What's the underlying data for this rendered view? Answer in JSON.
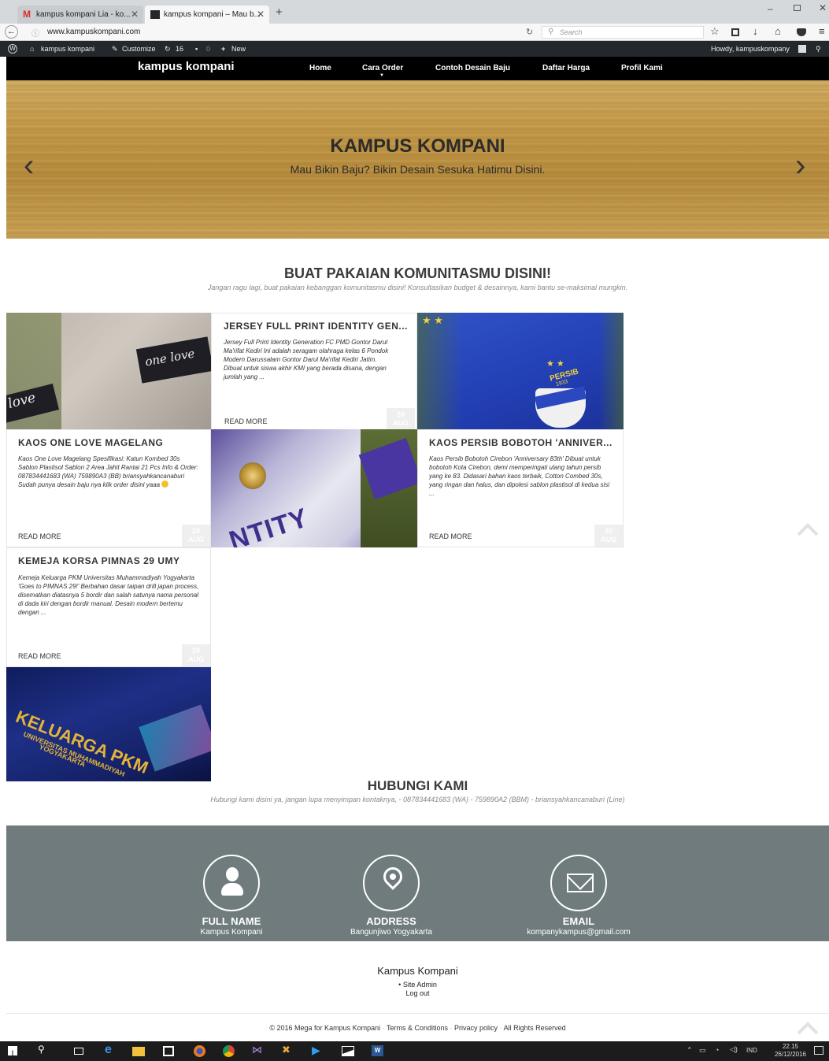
{
  "browser": {
    "tabs": [
      {
        "title": "kampus kompani Lia - ko..."
      },
      {
        "title": "kampus kompani – Mau b..."
      }
    ],
    "url": "www.kampuskompani.com",
    "search_placeholder": "Search"
  },
  "adminbar": {
    "site_name": "kampus kompani",
    "customize": "Customize",
    "updates_count": "16",
    "comments_count": "0",
    "new_label": "New",
    "howdy": "Howdy, kampuskompany"
  },
  "nav": {
    "brand": "kampus kompani",
    "items": [
      {
        "label": "Home"
      },
      {
        "label": "Cara Order"
      },
      {
        "label": "Contoh Desain Baju"
      },
      {
        "label": "Daftar Harga"
      },
      {
        "label": "Profil Kami"
      }
    ]
  },
  "hero": {
    "title": "KAMPUS KOMPANI",
    "subtitle": "Mau Bikin Baju? Bikin Desain Sesuka Hatimu Disini.",
    "prev": "‹",
    "next": "›"
  },
  "community": {
    "title": "BUAT PAKAIAN KOMUNITASMU DISINI!",
    "subtitle": "Jangan ragu lagi, buat pakaian kebanggan komunitasmu disini! Konsultasikan budget & desainnya, kami bantu se-maksimal mungkin."
  },
  "posts": [
    {
      "title": "JERSEY FULL PRINT IDENTITY GEN...",
      "excerpt": "Jersey Full Print Identity Generation FC PMD Gontor Darul Ma'rifat Kediri Ini adalah seragam olahraga kelas 6 Pondok Modern Darussalam Gontor Darul Ma'rifat Kediri Jatim. Dibuat untuk siswa akhir KMI yang berada disana, dengan jumlah yang ...",
      "read_more": "READ MORE",
      "day": "20",
      "month": "AUG"
    },
    {
      "title": "KAOS ONE LOVE MAGELANG",
      "excerpt": "Kaos One Love Magelang Spesifikasi: Katun Kombed 30s Sablon Plastisol Sablon 2 Area Jahit Rantai 21 Pcs Info & Order: 087834441683 (WA) 759890A3 (BB) briansyahkancanaburi Sudah punya desain baju nya klik order disini yaaa",
      "read_more": "READ MORE",
      "day": "20",
      "month": "AUG"
    },
    {
      "title": "KAOS PERSIB BOBOTOH 'ANNIVER...",
      "excerpt": "Kaos Persib Bobotoh Cirebon 'Anniversary 83th' Dibuat untuk bobotoh Kota Cirebon, demi memperingati ulang tahun persib yang ke 83. Didasari bahan kaos terbaik, Cotton Combed 30s, yang ringan dan halus, dan dipolesi sablon plastisol di kedua sisi ...",
      "read_more": "READ MORE",
      "day": "20",
      "month": "AUG"
    },
    {
      "title": "KEMEJA KORSA PIMNAS 29 UMY",
      "excerpt": "Kemeja Keluarga PKM Universitas Muhammadiyah Yogyakarta 'Goes to PIMNAS 29!' Berbahan dasar taipan drill japan process, disematkan diatasnya 5 bordir dan salah satunya nama personal di dada kiri dengan bordir manual. Desain modern bertemu dengan ...",
      "read_more": "READ MORE",
      "day": "20",
      "month": "AUG"
    }
  ],
  "image_text": {
    "one_love": "one love",
    "love": "love",
    "persib": "PERSIB",
    "persib_year": "1933",
    "entity": "NTITY",
    "keluarga": "KELUARGA PKM",
    "universitas": "UNIVERSITAS MUHAMMADIYAH",
    "yogyakarta": "YOGYAKARTA"
  },
  "contact": {
    "title": "HUBUNGI KAMI",
    "subtitle": "Hubungi kami disini ya, jangan lupa menyimpan kontaknya, - 087834441683 (WA) - 759890A2 (BBM) - briansyahkancanaburi (Line)",
    "items": [
      {
        "label": "FULL NAME",
        "value": "Kampus Kompani",
        "icon": "person-icon"
      },
      {
        "label": "ADDRESS",
        "value": "Bangunjiwo Yogyakarta",
        "icon": "location-pin-icon"
      },
      {
        "label": "EMAIL",
        "value": "kompanykampus@gmail.com",
        "icon": "envelope-icon"
      }
    ]
  },
  "widget": {
    "title": "Kampus Kompani",
    "site_admin": "Site Admin",
    "logout": "Log out"
  },
  "footer": {
    "copyright": "© 2016 Mega for Kampus Kompani",
    "terms": "Terms & Conditions",
    "privacy": "Privacy policy",
    "rights": "All Rights Reserved"
  },
  "taskbar": {
    "lang": "IND",
    "time": "22.15",
    "date": "26/12/2016"
  },
  "colors": {
    "adminbar": "#23282d",
    "nav": "#000000",
    "footer_band": "#6f7b7c",
    "accent_blue": "#1a63c7"
  }
}
